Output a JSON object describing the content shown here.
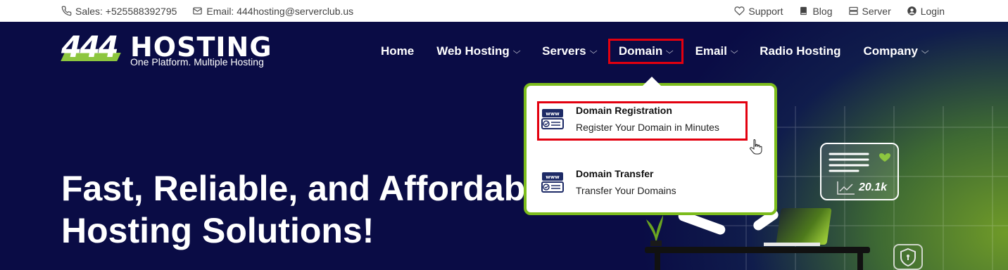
{
  "topbar": {
    "sales": "Sales: +525588392795",
    "email": "Email: 444hosting@serverclub.us",
    "support": "Support",
    "blog": "Blog",
    "server": "Server",
    "login": "Login"
  },
  "logo": {
    "number": "444",
    "word": "HOSTING",
    "tagline": "One Platform. Multiple Hosting"
  },
  "nav": {
    "items": [
      {
        "label": "Home"
      },
      {
        "label": "Web Hosting"
      },
      {
        "label": "Servers"
      },
      {
        "label": "Domain"
      },
      {
        "label": "Email"
      },
      {
        "label": "Radio Hosting"
      },
      {
        "label": "Company"
      }
    ]
  },
  "dropdown": {
    "items": [
      {
        "title": "Domain Registration",
        "subtitle": "Register Your Domain in Minutes",
        "icon": "www-domain-icon"
      },
      {
        "title": "Domain Transfer",
        "subtitle": "Transfer Your Domains",
        "icon": "www-domain-icon"
      }
    ]
  },
  "hero": {
    "line1": "Fast, Reliable, and Affordable",
    "line2": "Hosting Solutions!",
    "stat": "20.1k"
  },
  "colors": {
    "navy": "#0a0c45",
    "accent_green": "#7cbc1c",
    "highlight_red": "#e3000f"
  }
}
